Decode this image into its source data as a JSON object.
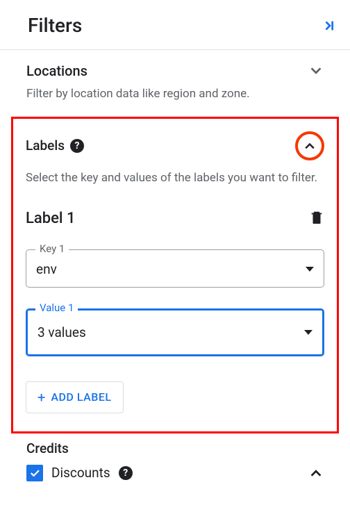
{
  "header": {
    "title": "Filters"
  },
  "locations": {
    "title": "Locations",
    "description": "Filter by location data like region and zone."
  },
  "labels": {
    "title": "Labels",
    "description": "Select the key and values of the labels you want to filter.",
    "item_title": "Label 1",
    "key_label": "Key 1",
    "key_value": "env",
    "value_label": "Value 1",
    "value_text": "3 values",
    "add_button": "ADD LABEL"
  },
  "credits": {
    "title": "Credits",
    "discounts_label": "Discounts"
  }
}
